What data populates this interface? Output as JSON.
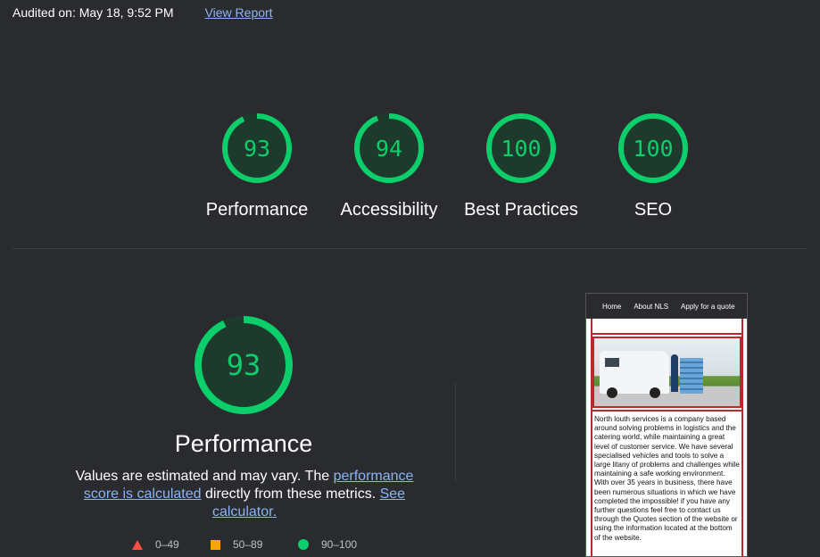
{
  "header": {
    "audited_text": "Audited on: May 18, 9:52 PM",
    "view_report": "View Report"
  },
  "scores": [
    {
      "value": 93,
      "label": "Performance"
    },
    {
      "value": 94,
      "label": "Accessibility"
    },
    {
      "value": 100,
      "label": "Best Practices"
    },
    {
      "value": 100,
      "label": "SEO"
    }
  ],
  "performance": {
    "score": 93,
    "title": "Performance",
    "desc_part1": "Values are estimated and may vary. The ",
    "desc_link1": "performance score is calculated",
    "desc_part2": " directly from these metrics. ",
    "desc_link2": "See calculator."
  },
  "legend": {
    "fail": "0–49",
    "average": "50–89",
    "pass": "90–100"
  },
  "screenshot": {
    "nav": [
      "Home",
      "About NLS",
      "Apply for a quote"
    ],
    "body_text": "North louth services is a company based around solving problems in logistics and the catering world, while maintaining a great level of customer service. We have several specialised vehicles and tools to solve a large litany of problems and challenges while maintaining a safe working environment. With over 35 years in business, there have been numerous situations in which we have completed the impossible! if you have any further questions feel free to contact us through the Quotes section of the website or using the information located at the bottom of the website."
  },
  "colors": {
    "pass": "#0cce6b",
    "pass_bg": "#1e3a2c",
    "average": "#ffa400",
    "fail": "#ff4e42",
    "background": "#2a2b2f",
    "link": "#8ab4f8"
  }
}
